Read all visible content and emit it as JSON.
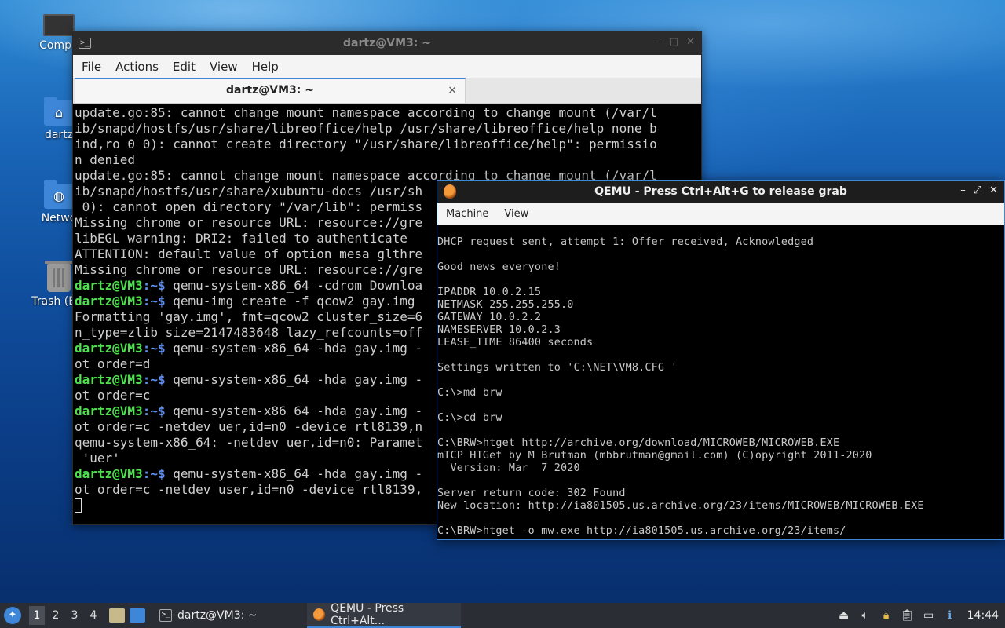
{
  "desktop": {
    "icons": [
      {
        "label": "Compu",
        "icon": "computer-icon"
      },
      {
        "label": "dartz",
        "icon": "home-folder-icon"
      },
      {
        "label": "Netwo",
        "icon": "network-folder-icon"
      },
      {
        "label": "Trash (Em",
        "icon": "trash-icon"
      }
    ]
  },
  "terminal": {
    "title": "dartz@VM3: ~",
    "menu": [
      "File",
      "Actions",
      "Edit",
      "View",
      "Help"
    ],
    "tab_label": "dartz@VM3: ~",
    "tab_close": "×",
    "prompt_user": "dartz@VM3",
    "prompt_suffix": ":~$ ",
    "lines": [
      {
        "text": "update.go:85: cannot change mount namespace according to change mount (/var/l"
      },
      {
        "text": "ib/snapd/hostfs/usr/share/libreoffice/help /usr/share/libreoffice/help none b"
      },
      {
        "text": "ind,ro 0 0): cannot create directory \"/usr/share/libreoffice/help\": permissio"
      },
      {
        "text": "n denied"
      },
      {
        "text": "update.go:85: cannot change mount namespace according to change mount (/var/l"
      },
      {
        "text": "ib/snapd/hostfs/usr/share/xubuntu-docs /usr/sh"
      },
      {
        "text": " 0): cannot open directory \"/var/lib\": permiss"
      },
      {
        "text": "Missing chrome or resource URL: resource://gre"
      },
      {
        "text": "libEGL warning: DRI2: failed to authenticate"
      },
      {
        "text": "ATTENTION: default value of option mesa_glthre"
      },
      {
        "text": "Missing chrome or resource URL: resource://gre"
      },
      {
        "prompt": true,
        "text": "qemu-system-x86_64 -cdrom Downloa"
      },
      {
        "prompt": true,
        "text": "qemu-img create -f qcow2 gay.img"
      },
      {
        "text": "Formatting 'gay.img', fmt=qcow2 cluster_size=6"
      },
      {
        "text": "n_type=zlib size=2147483648 lazy_refcounts=off"
      },
      {
        "prompt": true,
        "text": "qemu-system-x86_64 -hda gay.img -"
      },
      {
        "text": "ot order=d"
      },
      {
        "prompt": true,
        "text": "qemu-system-x86_64 -hda gay.img -"
      },
      {
        "text": "ot order=c"
      },
      {
        "prompt": true,
        "text": "qemu-system-x86_64 -hda gay.img -"
      },
      {
        "text": "ot order=c -netdev uer,id=n0 -device rtl8139,n"
      },
      {
        "text": "qemu-system-x86_64: -netdev uer,id=n0: Paramet"
      },
      {
        "text": " 'uer'"
      },
      {
        "prompt": true,
        "text": "qemu-system-x86_64 -hda gay.img -"
      },
      {
        "text": "ot order=c -netdev user,id=n0 -device rtl8139,"
      }
    ]
  },
  "qemu": {
    "title": "QEMU - Press Ctrl+Alt+G to release grab",
    "menu": [
      "Machine",
      "View"
    ],
    "screen_lines": [
      "DHCP request sent, attempt 1: Offer received, Acknowledged",
      "",
      "Good news everyone!",
      "",
      "IPADDR 10.0.2.15",
      "NETMASK 255.255.255.0",
      "GATEWAY 10.0.2.2",
      "NAMESERVER 10.0.2.3",
      "LEASE_TIME 86400 seconds",
      "",
      "Settings written to 'C:\\NET\\VM8.CFG '",
      "",
      "C:\\>md brw",
      "",
      "C:\\>cd brw",
      "",
      "C:\\BRW>htget http://archive.org/download/MICROWEB/MICROWEB.EXE",
      "mTCP HTGet by M Brutman (mbbrutman@gmail.com) (C)opyright 2011-2020",
      "  Version: Mar  7 2020",
      "",
      "Server return code: 302 Found",
      "New location: http://ia801505.us.archive.org/23/items/MICROWEB/MICROWEB.EXE",
      "",
      "C:\\BRW>htget -o mw.exe http://ia801505.us.archive.org/23/items/"
    ]
  },
  "taskbar": {
    "workspaces": [
      "1",
      "2",
      "3",
      "4"
    ],
    "active_workspace": "1",
    "tasks": [
      {
        "label": "dartz@VM3: ~",
        "icon": "terminal-icon",
        "active": false
      },
      {
        "label": "QEMU - Press Ctrl+Alt...",
        "icon": "qemu-icon",
        "active": true
      }
    ],
    "clock": "14:44",
    "colors": {
      "accent": "#3d86d8",
      "prompt_green": "#4ee04e",
      "prompt_blue": "#5c8ff0"
    }
  }
}
